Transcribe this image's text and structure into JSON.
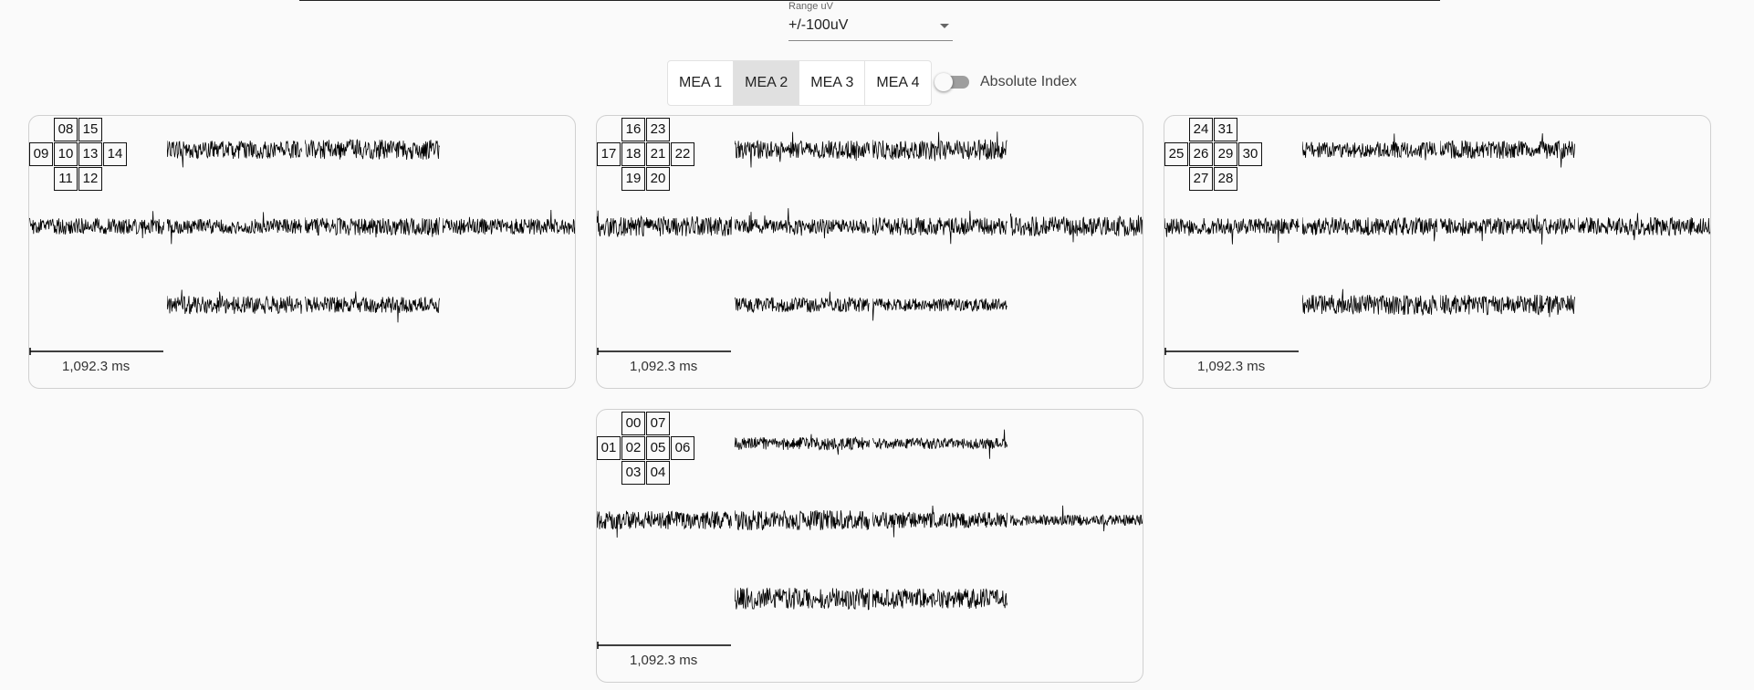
{
  "range": {
    "label": "Range uV",
    "value": "+/-100uV"
  },
  "tabs": [
    {
      "label": "MEA 1",
      "active": false
    },
    {
      "label": "MEA 2",
      "active": true
    },
    {
      "label": "MEA 3",
      "active": false
    },
    {
      "label": "MEA 4",
      "active": false
    }
  ],
  "absolute_index": {
    "label": "Absolute Index",
    "on": false
  },
  "panels": [
    {
      "channels": {
        "top": [
          "08",
          "15"
        ],
        "middle": [
          "09",
          "10",
          "13",
          "14"
        ],
        "bottom": [
          "11",
          "12"
        ]
      },
      "time_label": "1,092.3 ms"
    },
    {
      "channels": {
        "top": [
          "16",
          "23"
        ],
        "middle": [
          "17",
          "18",
          "21",
          "22"
        ],
        "bottom": [
          "19",
          "20"
        ]
      },
      "time_label": "1,092.3 ms"
    },
    {
      "channels": {
        "top": [
          "24",
          "31"
        ],
        "middle": [
          "25",
          "26",
          "29",
          "30"
        ],
        "bottom": [
          "27",
          "28"
        ]
      },
      "time_label": "1,092.3 ms"
    },
    {
      "channels": {
        "top": [
          "00",
          "07"
        ],
        "middle": [
          "01",
          "02",
          "05",
          "06"
        ],
        "bottom": [
          "03",
          "04"
        ]
      },
      "time_label": "1,092.3 ms"
    }
  ]
}
